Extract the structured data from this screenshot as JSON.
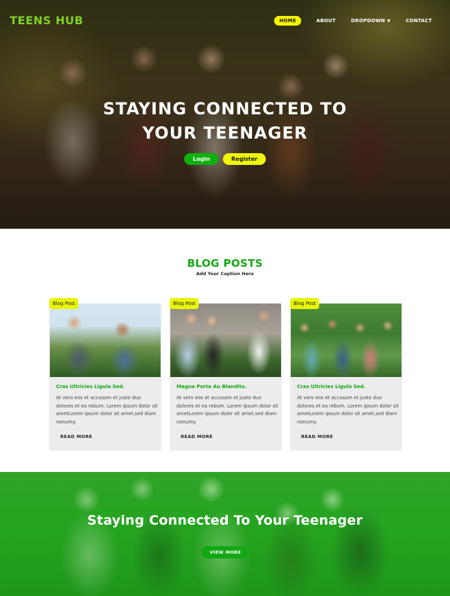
{
  "header": {
    "logo": "TEENS HUB",
    "nav": [
      {
        "label": "HOME",
        "active": true
      },
      {
        "label": "ABOUT",
        "active": false
      },
      {
        "label": "DROPDOWN",
        "active": false
      },
      {
        "label": "CONTACT",
        "active": false
      }
    ],
    "dropdown_icon": "▼"
  },
  "hero": {
    "title_line1": "STAYING CONNECTED TO",
    "title_line2": "YOUR TEENAGER",
    "login_label": "Login",
    "register_label": "Register"
  },
  "blog": {
    "title": "BLOG POSTS",
    "caption": "Add Your Caption Here",
    "posts": [
      {
        "badge": "Blog Post",
        "title": "Cras Ultricies Ligula Sed.",
        "text": "At vero eos et accusam et justo duo dolores et ea rebum. Lorem ipsum dolor sit ametLorem ipsum dolor sit amet,sed diam nonumy.",
        "more": "READ MORE"
      },
      {
        "badge": "Blog Post",
        "title": "Magna Porta Au Blandito.",
        "text": "At vero eos et accusam et justo duo dolores et ea rebum. Lorem ipsum dolor sit ametLorem ipsum dolor sit amet,sed diam nonumy.",
        "more": "READ MORE"
      },
      {
        "badge": "Blog Post",
        "title": "Cras Ultricies Ligula Sed.",
        "text": "At vero eos et accusam et justo duo dolores et ea rebum. Lorem ipsum dolor sit ametLorem ipsum dolor sit amet,sed diam nonumy.",
        "more": "READ MORE"
      }
    ]
  },
  "cta": {
    "title": "Staying Connected To Your Teenager",
    "button": "VIEW MORE"
  },
  "colors": {
    "brand_green": "#13a813",
    "logo_green": "#7fd321",
    "accent_yellow": "#f0f50a"
  }
}
